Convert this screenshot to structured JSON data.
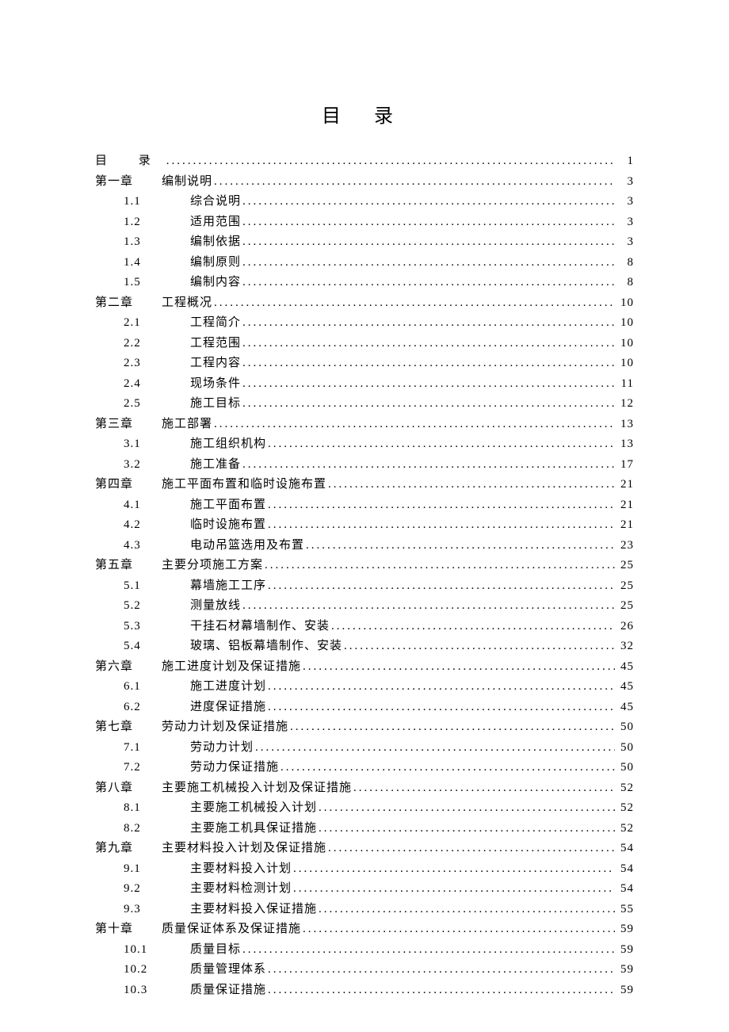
{
  "title": "目 录",
  "toc": [
    {
      "level": 0,
      "num": "目 录",
      "label": "",
      "page": "1"
    },
    {
      "level": 1,
      "num": "第一章",
      "label": "编制说明",
      "page": "3"
    },
    {
      "level": 2,
      "num": "1.1",
      "label": "综合说明",
      "page": "3"
    },
    {
      "level": 2,
      "num": "1.2",
      "label": "适用范围",
      "page": "3"
    },
    {
      "level": 2,
      "num": "1.3",
      "label": "编制依据",
      "page": "3"
    },
    {
      "level": 2,
      "num": "1.4",
      "label": "编制原则",
      "page": "8"
    },
    {
      "level": 2,
      "num": "1.5",
      "label": "编制内容",
      "page": "8"
    },
    {
      "level": 1,
      "num": "第二章",
      "label": "工程概况",
      "page": "10"
    },
    {
      "level": 2,
      "num": "2.1",
      "label": "工程简介",
      "page": "10"
    },
    {
      "level": 2,
      "num": "2.2",
      "label": "工程范围",
      "page": "10"
    },
    {
      "level": 2,
      "num": "2.3",
      "label": "工程内容",
      "page": "10"
    },
    {
      "level": 2,
      "num": "2.4",
      "label": "现场条件",
      "page": "11"
    },
    {
      "level": 2,
      "num": "2.5",
      "label": "施工目标",
      "page": "12"
    },
    {
      "level": 1,
      "num": "第三章",
      "label": "施工部署",
      "page": "13"
    },
    {
      "level": 2,
      "num": "3.1",
      "label": "施工组织机构",
      "page": "13"
    },
    {
      "level": 2,
      "num": "3.2",
      "label": "施工准备",
      "page": "17"
    },
    {
      "level": 1,
      "num": "第四章",
      "label": "施工平面布置和临时设施布置",
      "page": "21"
    },
    {
      "level": 2,
      "num": "4.1",
      "label": "施工平面布置",
      "page": "21"
    },
    {
      "level": 2,
      "num": "4.2",
      "label": "临时设施布置",
      "page": "21"
    },
    {
      "level": 2,
      "num": "4.3",
      "label": "电动吊篮选用及布置",
      "page": "23"
    },
    {
      "level": 1,
      "num": "第五章",
      "label": "主要分项施工方案",
      "page": "25"
    },
    {
      "level": 2,
      "num": "5.1",
      "label": "幕墙施工工序",
      "page": "25"
    },
    {
      "level": 2,
      "num": "5.2",
      "label": "测量放线",
      "page": "25"
    },
    {
      "level": 2,
      "num": "5.3",
      "label": "干挂石材幕墙制作、安装",
      "page": "26"
    },
    {
      "level": 2,
      "num": "5.4",
      "label": "玻璃、铝板幕墙制作、安装",
      "page": "32"
    },
    {
      "level": 1,
      "num": "第六章",
      "label": "施工进度计划及保证措施",
      "page": "45"
    },
    {
      "level": 2,
      "num": "6.1",
      "label": "施工进度计划",
      "page": "45"
    },
    {
      "level": 2,
      "num": "6.2",
      "label": "进度保证措施",
      "page": "45"
    },
    {
      "level": 1,
      "num": "第七章",
      "label": "劳动力计划及保证措施",
      "page": "50"
    },
    {
      "level": 2,
      "num": "7.1",
      "label": "劳动力计划",
      "page": "50"
    },
    {
      "level": 2,
      "num": "7.2",
      "label": "劳动力保证措施",
      "page": "50"
    },
    {
      "level": 1,
      "num": "第八章",
      "label": "主要施工机械投入计划及保证措施",
      "page": "52"
    },
    {
      "level": 2,
      "num": "8.1",
      "label": "主要施工机械投入计划",
      "page": "52"
    },
    {
      "level": 2,
      "num": "8.2",
      "label": "主要施工机具保证措施",
      "page": "52"
    },
    {
      "level": 1,
      "num": "第九章",
      "label": "主要材料投入计划及保证措施",
      "page": "54"
    },
    {
      "level": 2,
      "num": "9.1",
      "label": "主要材料投入计划",
      "page": "54"
    },
    {
      "level": 2,
      "num": "9.2",
      "label": "主要材料检测计划",
      "page": "54"
    },
    {
      "level": 2,
      "num": "9.3",
      "label": "主要材料投入保证措施",
      "page": "55"
    },
    {
      "level": 1,
      "num": "第十章",
      "label": "质量保证体系及保证措施",
      "page": "59"
    },
    {
      "level": 3,
      "num": "10.1",
      "label": "质量目标",
      "page": "59"
    },
    {
      "level": 3,
      "num": "10.2",
      "label": "质量管理体系",
      "page": "59"
    },
    {
      "level": 3,
      "num": "10.3",
      "label": "质量保证措施",
      "page": "59"
    }
  ]
}
